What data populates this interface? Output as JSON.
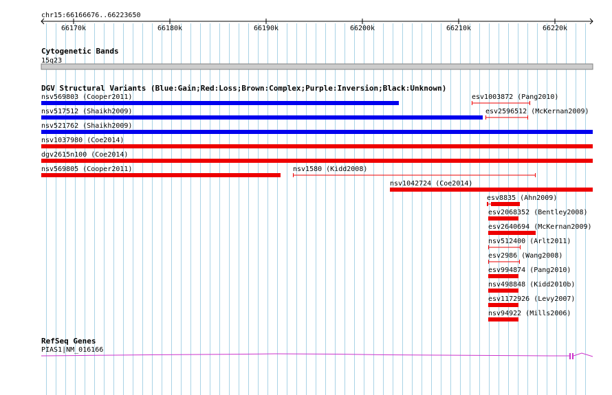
{
  "colors": {
    "grid": "#a9d3e6",
    "gain": "#0000ee",
    "loss": "#ee0000",
    "gene": "#cc33cc",
    "text": "#000000",
    "band": "#cccccc"
  },
  "ruler": {
    "label": "chr15:66166676..66223650",
    "ticks": [
      "66170k",
      "66180k",
      "66190k",
      "66200k",
      "66210k",
      "66220k"
    ]
  },
  "tracks": {
    "cytoband": {
      "title": "Cytogenetic Bands",
      "band_label": "15q23"
    },
    "dgv": {
      "title": "DGV Structural Variants (Blue:Gain;Red:Loss;Brown:Complex;Purple:Inversion;Black:Unknown)",
      "features": [
        {
          "label": "nsv569803 (Cooper2011)",
          "type": "gain",
          "style": "thick"
        },
        {
          "label": "esv1003872 (Pang2010)",
          "type": "loss",
          "style": "thin"
        },
        {
          "label": "nsv517512 (Shaikh2009)",
          "type": "gain",
          "style": "thick"
        },
        {
          "label": "esv2596512 (McKernan2009)",
          "type": "loss",
          "style": "thin"
        },
        {
          "label": "nsv521762 (Shaikh2009)",
          "type": "gain",
          "style": "thick"
        },
        {
          "label": "nsv1037980 (Coe2014)",
          "type": "loss",
          "style": "thick"
        },
        {
          "label": "dgv2615n100 (Coe2014)",
          "type": "loss",
          "style": "thick"
        },
        {
          "label": "nsv569805 (Cooper2011)",
          "type": "loss",
          "style": "thick"
        },
        {
          "label": "nsv1580 (Kidd2008)",
          "type": "loss",
          "style": "thin"
        },
        {
          "label": "nsv1042724 (Coe2014)",
          "type": "loss",
          "style": "thick"
        },
        {
          "label": "esv8835 (Ahn2009)",
          "type": "loss",
          "style": "mixed"
        },
        {
          "label": "esv2068352 (Bentley2008)",
          "type": "loss",
          "style": "thick"
        },
        {
          "label": "esv2640694 (McKernan2009)",
          "type": "loss",
          "style": "thick"
        },
        {
          "label": "nsv512400 (Arlt2011)",
          "type": "loss",
          "style": "thin"
        },
        {
          "label": "esv2986 (Wang2008)",
          "type": "loss",
          "style": "thin"
        },
        {
          "label": "esv994874 (Pang2010)",
          "type": "loss",
          "style": "thick"
        },
        {
          "label": "nsv498848 (Kidd2010b)",
          "type": "loss",
          "style": "thick"
        },
        {
          "label": "esv1172926 (Levy2007)",
          "type": "loss",
          "style": "thick"
        },
        {
          "label": "nsv94922 (Mills2006)",
          "type": "loss",
          "style": "thick"
        }
      ]
    },
    "refseq": {
      "title": "RefSeq Genes",
      "gene_label": "PIAS1|NM_016166"
    }
  }
}
